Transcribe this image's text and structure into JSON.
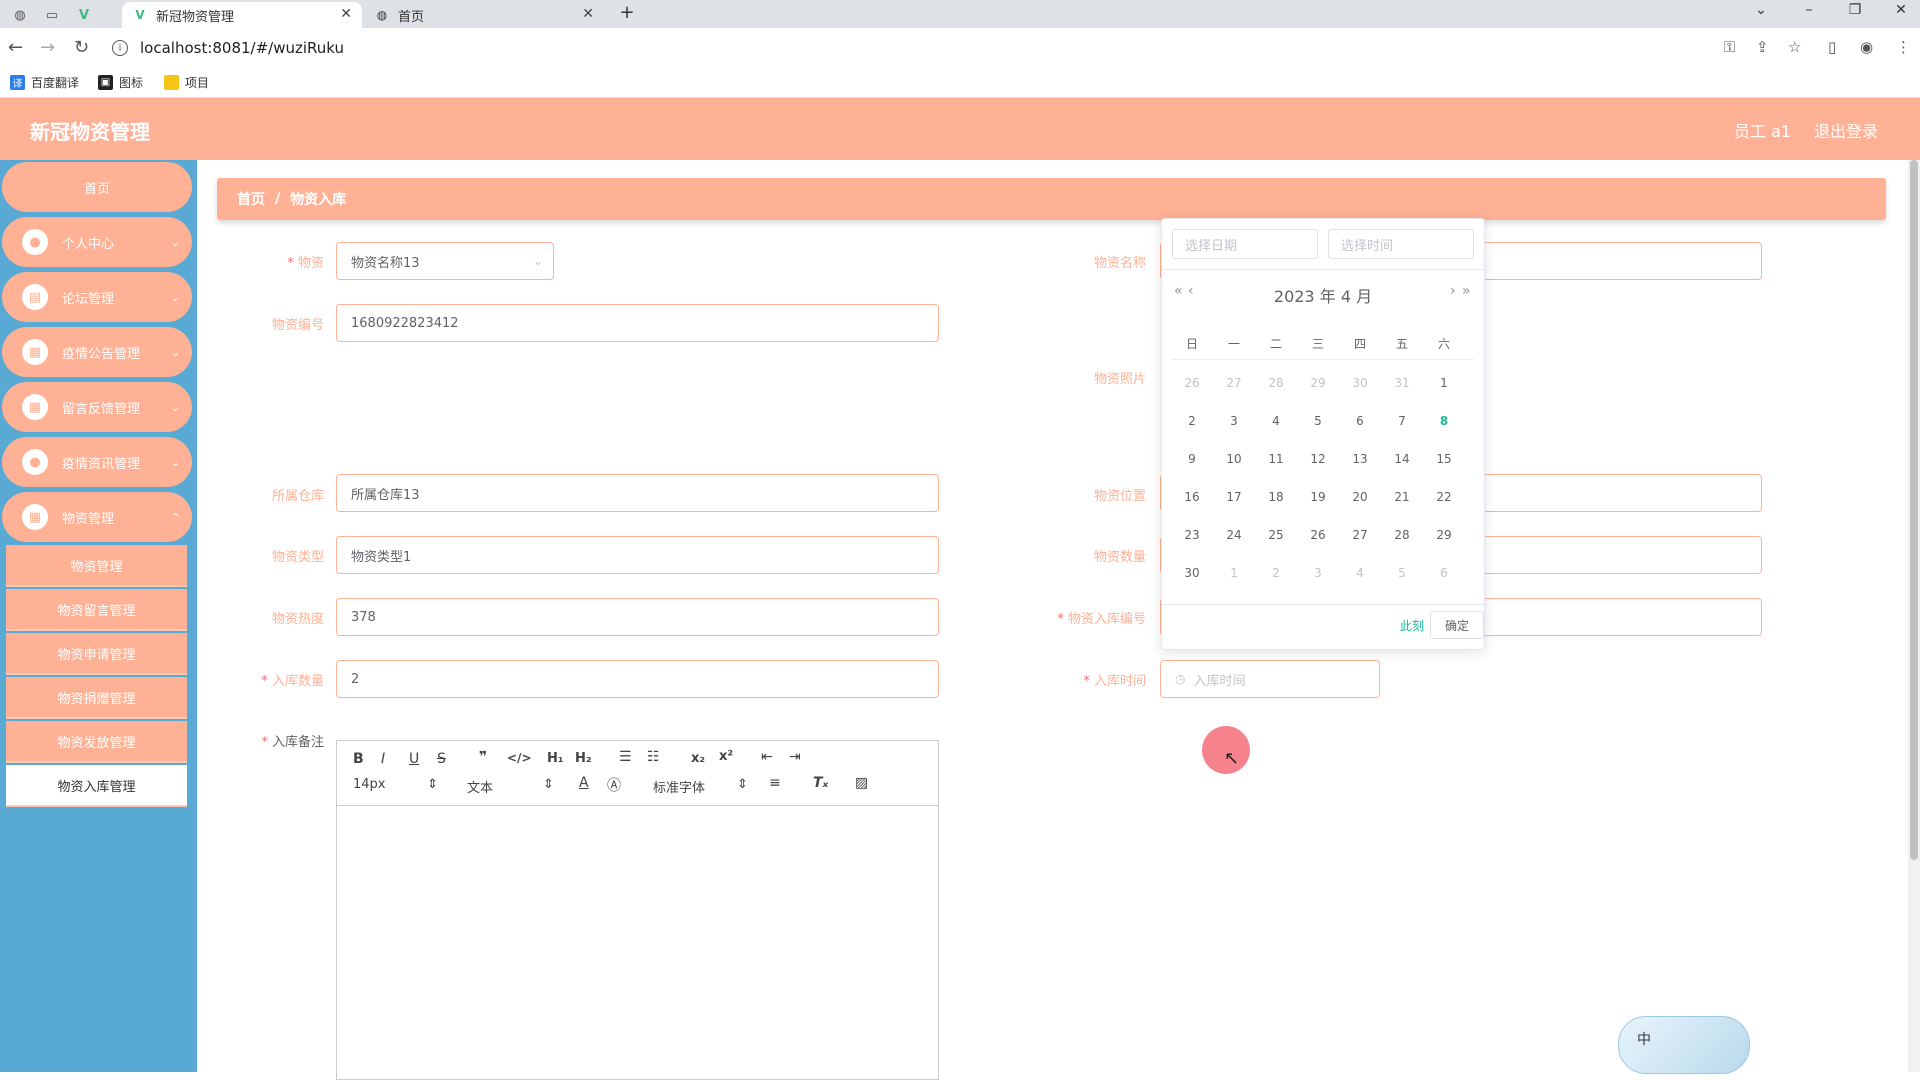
{
  "browser": {
    "tabs": [
      {
        "title": "新冠物资管理",
        "active": true
      },
      {
        "title": "首页",
        "active": false
      }
    ],
    "url": "localhost:8081/#/wuziRuku",
    "bookmarks": [
      "百度翻译",
      "图标",
      "项目"
    ]
  },
  "header": {
    "title": "新冠物资管理",
    "user": "员工 a1",
    "logout": "退出登录"
  },
  "sidebar": {
    "items": [
      {
        "label": "首页"
      },
      {
        "label": "个人中心"
      },
      {
        "label": "论坛管理"
      },
      {
        "label": "疫情公告管理"
      },
      {
        "label": "留言反馈管理"
      },
      {
        "label": "疫情资讯管理"
      },
      {
        "label": "物资管理"
      }
    ],
    "submenu": [
      {
        "label": "物资管理"
      },
      {
        "label": "物资留言管理"
      },
      {
        "label": "物资申请管理"
      },
      {
        "label": "物资捐赠管理"
      },
      {
        "label": "物资发放管理"
      },
      {
        "label": "物资入库管理"
      }
    ]
  },
  "breadcrumb": {
    "home": "首页",
    "sep": "/",
    "current": "物资入库"
  },
  "form": {
    "wuzi": {
      "label": "物资",
      "value": "物资名称13"
    },
    "wuzi_name": {
      "label": "物资名称"
    },
    "wuzi_code": {
      "label": "物资编号",
      "value": "1680922823412"
    },
    "wuzi_photo": {
      "label": "物资照片"
    },
    "warehouse": {
      "label": "所属仓库",
      "value": "所属仓库13"
    },
    "location": {
      "label": "物资位置"
    },
    "type": {
      "label": "物资类型",
      "value": "物资类型1"
    },
    "quantity": {
      "label": "物资数量"
    },
    "heat": {
      "label": "物资热度",
      "value": "378"
    },
    "ruku_code": {
      "label": "物资入库编号"
    },
    "ruku_number": {
      "label": "入库数量",
      "value": "2"
    },
    "ruku_time": {
      "label": "入库时间",
      "placeholder": "入库时间"
    },
    "remark": {
      "label": "入库备注"
    }
  },
  "editor": {
    "font_size": "14px",
    "text_style": "文本",
    "font_family": "标准字体"
  },
  "picker": {
    "date_placeholder": "选择日期",
    "time_placeholder": "选择时间",
    "year": "2023",
    "year_suffix": "年",
    "month": "4",
    "month_suffix": "月",
    "weekdays": [
      "日",
      "一",
      "二",
      "三",
      "四",
      "五",
      "六"
    ],
    "weeks": [
      [
        {
          "d": "26",
          "o": true
        },
        {
          "d": "27",
          "o": true
        },
        {
          "d": "28",
          "o": true
        },
        {
          "d": "29",
          "o": true
        },
        {
          "d": "30",
          "o": true
        },
        {
          "d": "31",
          "o": true
        },
        {
          "d": "1"
        }
      ],
      [
        {
          "d": "2"
        },
        {
          "d": "3"
        },
        {
          "d": "4"
        },
        {
          "d": "5"
        },
        {
          "d": "6"
        },
        {
          "d": "7"
        },
        {
          "d": "8",
          "t": true
        }
      ],
      [
        {
          "d": "9"
        },
        {
          "d": "10"
        },
        {
          "d": "11"
        },
        {
          "d": "12"
        },
        {
          "d": "13"
        },
        {
          "d": "14"
        },
        {
          "d": "15"
        }
      ],
      [
        {
          "d": "16"
        },
        {
          "d": "17"
        },
        {
          "d": "18"
        },
        {
          "d": "19"
        },
        {
          "d": "20"
        },
        {
          "d": "21"
        },
        {
          "d": "22"
        }
      ],
      [
        {
          "d": "23"
        },
        {
          "d": "24"
        },
        {
          "d": "25"
        },
        {
          "d": "26"
        },
        {
          "d": "27"
        },
        {
          "d": "28"
        },
        {
          "d": "29"
        }
      ],
      [
        {
          "d": "30"
        },
        {
          "d": "1",
          "o": true
        },
        {
          "d": "2",
          "o": true
        },
        {
          "d": "3",
          "o": true
        },
        {
          "d": "4",
          "o": true
        },
        {
          "d": "5",
          "o": true
        },
        {
          "d": "6",
          "o": true
        }
      ]
    ],
    "now_label": "此刻",
    "ok_label": "确定"
  },
  "ime": {
    "label": "中"
  },
  "colors": {
    "accent": "#ffb195",
    "sidebar": "#58a9d4",
    "today": "#1abc9c"
  }
}
